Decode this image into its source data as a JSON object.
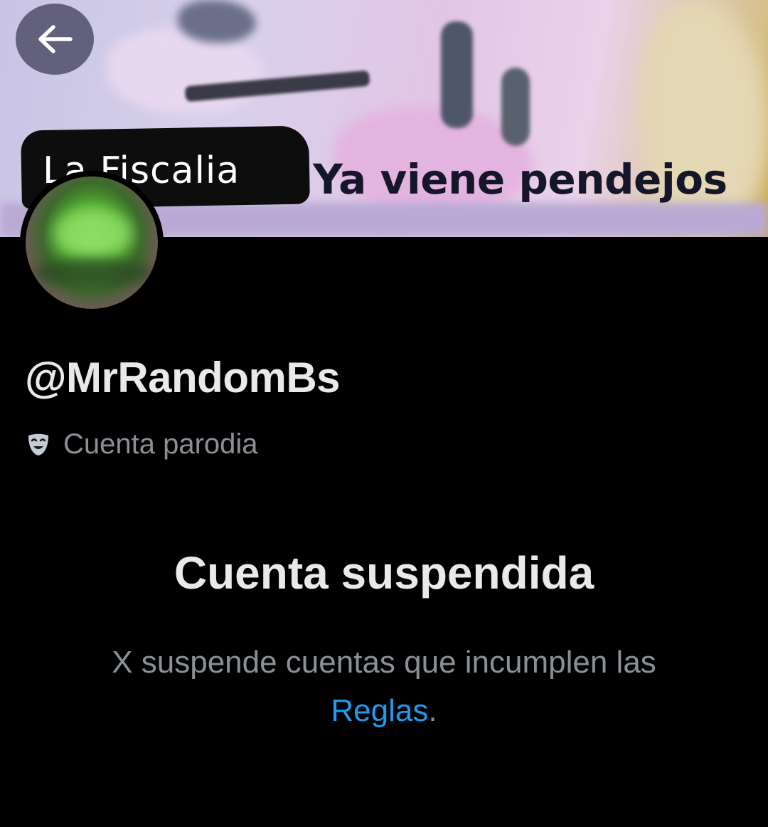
{
  "header": {
    "banner_caption_left": "La Fiscalia",
    "banner_caption_right": "Ya viene pendejos",
    "back_icon": "arrow-left-icon"
  },
  "profile": {
    "handle": "@MrRandomBs",
    "badge_icon": "parody-mask-icon",
    "badge_label": "Cuenta parodia"
  },
  "suspension": {
    "title": "Cuenta suspendida",
    "description_prefix": "X suspende cuentas que incumplen las",
    "link_label": "Reglas",
    "description_suffix": "."
  },
  "colors": {
    "background": "#000000",
    "primary_text": "#e7e9ea",
    "secondary_text": "#8b8f96",
    "link": "#1d9bf0"
  }
}
